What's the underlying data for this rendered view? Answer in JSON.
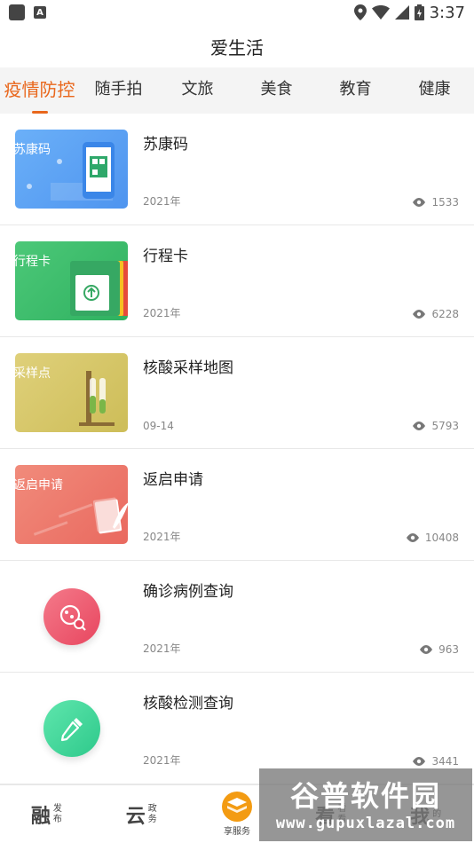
{
  "status_bar": {
    "time": "3:37",
    "notif_icon_label": "A"
  },
  "header": {
    "title": "爱生活"
  },
  "tabs": [
    {
      "label": "疫情防控",
      "active": true
    },
    {
      "label": "随手拍"
    },
    {
      "label": "文旅"
    },
    {
      "label": "美食"
    },
    {
      "label": "教育"
    },
    {
      "label": "健康"
    }
  ],
  "items": [
    {
      "title": "苏康码",
      "thumb_label": "苏康码",
      "date": "2021年",
      "views": "1533"
    },
    {
      "title": "行程卡",
      "thumb_label": "行程卡",
      "date": "2021年",
      "views": "6228"
    },
    {
      "title": "核酸采样地图",
      "thumb_label": "采样点",
      "date": "09-14",
      "views": "5793"
    },
    {
      "title": "返启申请",
      "thumb_label": "返启申请",
      "date": "2021年",
      "views": "10408"
    },
    {
      "title": "确诊病例查询",
      "date": "2021年",
      "views": "963"
    },
    {
      "title": "核酸检测查询",
      "date": "2021年",
      "views": "3441"
    }
  ],
  "bottom_nav": {
    "rong": {
      "big": "融",
      "small": "发布"
    },
    "yun": {
      "big": "云",
      "small": "政务"
    },
    "center": {
      "label": "享服务"
    },
    "four": {
      "big": "看",
      "small": "看看"
    },
    "five": {
      "big": "我",
      "small": "的"
    }
  },
  "watermark": {
    "top": "谷普软件园",
    "bottom": "www.gupuxlazal.com"
  },
  "colors": {
    "accent": "#e9671c",
    "sukang_thumb": "#5fa4f5",
    "xingcheng_thumb": "#3fbf6c",
    "caiyang_thumb": "#d9c96a",
    "fanqi_thumb": "#ee7a6e",
    "quezhen_circle": "#ef5b74",
    "hesuan_circle": "#3ed79b"
  }
}
